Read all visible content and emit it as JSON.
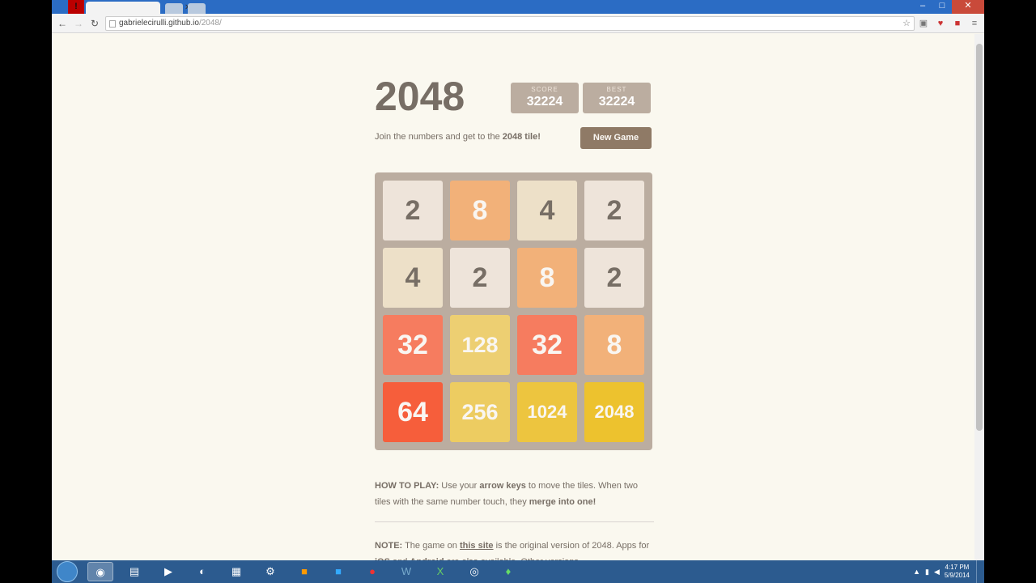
{
  "browser": {
    "url_host": "gabrielecirulli.github.io",
    "url_path": "/2048/"
  },
  "game": {
    "title": "2048",
    "score_label": "score",
    "score_value": "32224",
    "best_label": "best",
    "best_value": "32224",
    "intro_prefix": "Join the numbers and get to the ",
    "intro_bold": "2048 tile!",
    "new_game_label": "New Game",
    "tiles": [
      [
        "2",
        "8",
        "4",
        "2"
      ],
      [
        "4",
        "2",
        "8",
        "2"
      ],
      [
        "32",
        "128",
        "32",
        "8"
      ],
      [
        "64",
        "256",
        "1024",
        "2048"
      ]
    ]
  },
  "howto": {
    "label": "HOW TO PLAY:",
    "text1": " Use your ",
    "bold1": "arrow keys",
    "text2": " to move the tiles. When two tiles with the same number touch, they ",
    "bold2": "merge into one!"
  },
  "note": {
    "label": "NOTE:",
    "text1": " The game on ",
    "link": "this site",
    "text2": " is the original version of 2048. Apps for ",
    "bold_ios": "iOS",
    "text3": " and ",
    "bold_android": "Android",
    "text4": " are also available. Other versions"
  },
  "taskbar": {
    "clock_time": "4:17 PM",
    "clock_date": "5/9/2014"
  },
  "colors": {
    "page_bg": "#faf8ef",
    "board_bg": "#bbada0",
    "tile_2": "#eee4da",
    "tile_4": "#ede0c8",
    "tile_8": "#f2b179",
    "tile_32": "#f67c5f",
    "tile_64": "#f65e3b",
    "tile_128": "#edcf72",
    "tile_256": "#edcc61",
    "tile_1024": "#edc53f",
    "tile_2048": "#edc22e"
  }
}
